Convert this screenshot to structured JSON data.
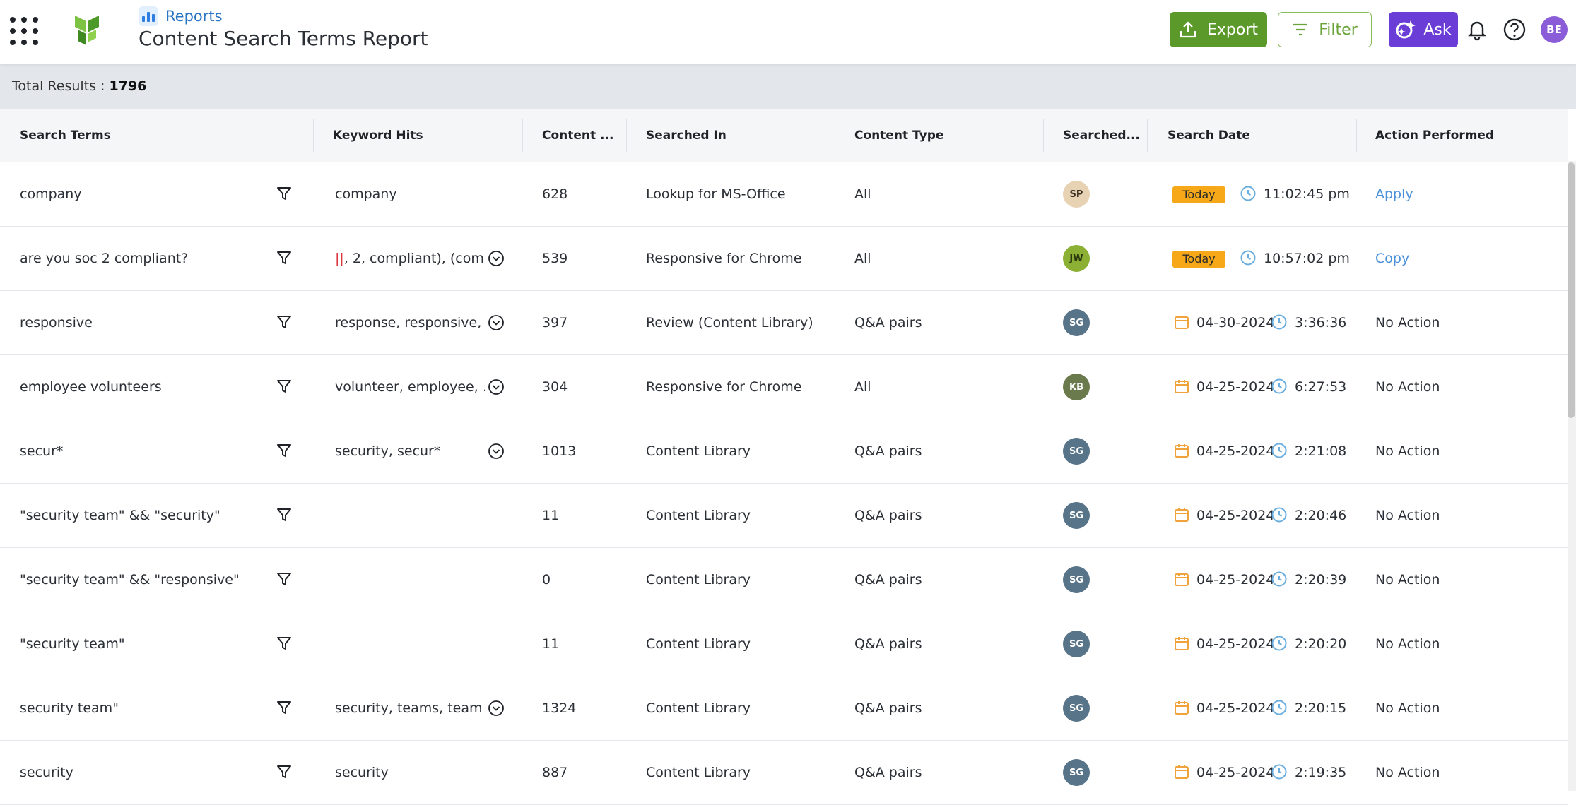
{
  "header": {
    "breadcrumb": "Reports",
    "title": "Content Search Terms Report",
    "export_label": "Export",
    "filter_label": "Filter",
    "ask_label": "Ask",
    "user_initials": "BE"
  },
  "summary": {
    "label": "Total Results : ",
    "total": "1796"
  },
  "columns": [
    "Search Terms",
    "Keyword Hits",
    "Content ...",
    "Searched In",
    "Content Type",
    "Searched...",
    "Search Date",
    "Action Performed"
  ],
  "rows": [
    {
      "term": "company",
      "hits": "company",
      "hits_expandable": false,
      "count": "628",
      "searched_in": "Lookup for MS-Office",
      "content_type": "All",
      "user": "SP",
      "user_color": "#e8d2b4",
      "user_text": "#3a2f22",
      "today": true,
      "date": "",
      "time": "11:02:45 pm",
      "action": "Apply",
      "action_link": true
    },
    {
      "term": "are you soc 2 compliant?",
      "hits_pipe": "||",
      "hits": ", 2, compliant), (com…",
      "hits_expandable": true,
      "count": "539",
      "searched_in": "Responsive for Chrome",
      "content_type": "All",
      "user": "JW",
      "user_color": "#8bb033",
      "user_text": "#2d3a10",
      "today": true,
      "date": "",
      "time": "10:57:02 pm",
      "action": "Copy",
      "action_link": true
    },
    {
      "term": "responsive",
      "hits": "response, responsive, …",
      "hits_expandable": true,
      "count": "397",
      "searched_in": "Review (Content Library)",
      "content_type": "Q&A pairs",
      "user": "SG",
      "user_color": "#587488",
      "user_text": "#ffffff",
      "today": false,
      "date": "04-30-2024",
      "time": "3:36:36",
      "action": "No Action",
      "action_link": false
    },
    {
      "term": "employee volunteers",
      "hits": "volunteer, employee, …",
      "hits_expandable": true,
      "count": "304",
      "searched_in": "Responsive for Chrome",
      "content_type": "All",
      "user": "KB",
      "user_color": "#6b7a4d",
      "user_text": "#ffffff",
      "today": false,
      "date": "04-25-2024",
      "time": "6:27:53",
      "action": "No Action",
      "action_link": false
    },
    {
      "term": "secur*",
      "hits": "security, secur*",
      "hits_expandable": true,
      "count": "1013",
      "searched_in": "Content Library",
      "content_type": "Q&A pairs",
      "user": "SG",
      "user_color": "#587488",
      "user_text": "#ffffff",
      "today": false,
      "date": "04-25-2024",
      "time": "2:21:08",
      "action": "No Action",
      "action_link": false
    },
    {
      "term": "\"security team\" && \"security\"",
      "hits": "",
      "hits_expandable": false,
      "count": "11",
      "searched_in": "Content Library",
      "content_type": "Q&A pairs",
      "user": "SG",
      "user_color": "#587488",
      "user_text": "#ffffff",
      "today": false,
      "date": "04-25-2024",
      "time": "2:20:46",
      "action": "No Action",
      "action_link": false
    },
    {
      "term": "\"security team\" && \"responsive\"",
      "hits": "",
      "hits_expandable": false,
      "count": "0",
      "searched_in": "Content Library",
      "content_type": "Q&A pairs",
      "user": "SG",
      "user_color": "#587488",
      "user_text": "#ffffff",
      "today": false,
      "date": "04-25-2024",
      "time": "2:20:39",
      "action": "No Action",
      "action_link": false
    },
    {
      "term": "\"security team\"",
      "hits": "",
      "hits_expandable": false,
      "count": "11",
      "searched_in": "Content Library",
      "content_type": "Q&A pairs",
      "user": "SG",
      "user_color": "#587488",
      "user_text": "#ffffff",
      "today": false,
      "date": "04-25-2024",
      "time": "2:20:20",
      "action": "No Action",
      "action_link": false
    },
    {
      "term": "security team\"",
      "hits": "security, teams, team",
      "hits_expandable": true,
      "count": "1324",
      "searched_in": "Content Library",
      "content_type": "Q&A pairs",
      "user": "SG",
      "user_color": "#587488",
      "user_text": "#ffffff",
      "today": false,
      "date": "04-25-2024",
      "time": "2:20:15",
      "action": "No Action",
      "action_link": false
    },
    {
      "term": "security",
      "hits": "security",
      "hits_expandable": false,
      "count": "887",
      "searched_in": "Content Library",
      "content_type": "Q&A pairs",
      "user": "SG",
      "user_color": "#587488",
      "user_text": "#ffffff",
      "today": false,
      "date": "04-25-2024",
      "time": "2:19:35",
      "action": "No Action",
      "action_link": false
    }
  ],
  "today_label": "Today",
  "colors": {
    "export": "#5b9a2a",
    "ask": "#6a3ed6",
    "today_badge": "#f6a818",
    "link": "#4a90d9",
    "calendar": "#f0a33a",
    "clock": "#6aaee0"
  }
}
